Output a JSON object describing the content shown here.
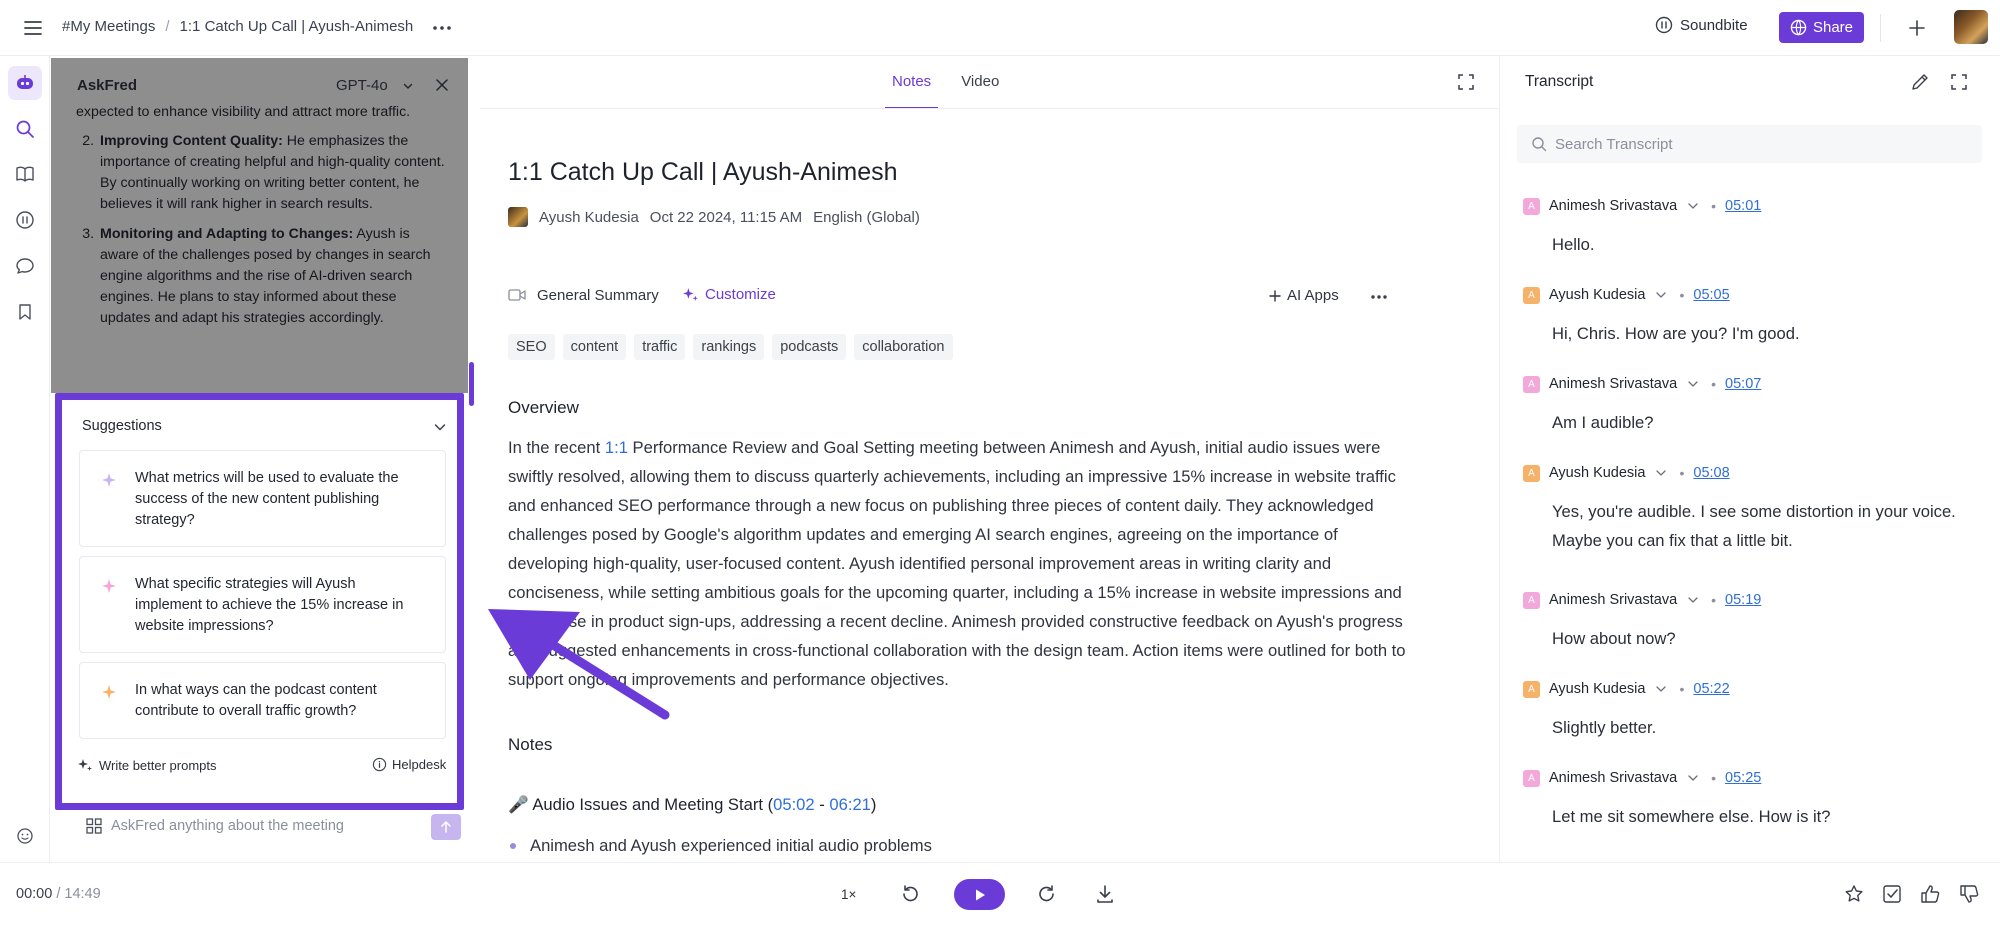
{
  "header": {
    "breadcrumb_root": "#My Meetings",
    "breadcrumb_sep": "/",
    "breadcrumb_current": "1:1 Catch Up Call | Ayush-Animesh",
    "soundbite_label": "Soundbite",
    "share_label": "Share"
  },
  "askfred": {
    "title": "AskFred",
    "model": "GPT-4o",
    "partial_top": "expected to enhance visibility and attract more traffic.",
    "items": [
      {
        "bold": "Improving Content Quality:",
        "text": " He emphasizes the importance of creating helpful and high-quality content. By continually working on writing better content, he believes it will rank higher in search results."
      },
      {
        "bold": "Monitoring and Adapting to Changes:",
        "text": " Ayush is aware of the challenges posed by changes in search engine algorithms and the rise of AI-driven search engines. He plans to stay informed about these updates and adapt his strategies accordingly."
      }
    ],
    "suggestions_label": "Suggestions",
    "suggestions": [
      "What metrics will be used to evaluate the success of the new content publishing strategy?",
      "What specific strategies will Ayush implement to achieve the 15% increase in website impressions?",
      "In what ways can the podcast content contribute to overall traffic growth?"
    ],
    "write_better": "Write better prompts",
    "helpdesk": "Helpdesk",
    "input_placeholder": "AskFred anything about the meeting"
  },
  "center": {
    "tab_notes": "Notes",
    "tab_video": "Video",
    "title": "1:1 Catch Up Call | Ayush-Animesh",
    "author": "Ayush Kudesia",
    "date": "Oct 22 2024, 11:15 AM",
    "language": "English (Global)",
    "general_summary": "General Summary",
    "customize": "Customize",
    "ai_apps": "AI Apps",
    "tags": [
      "SEO",
      "content",
      "traffic",
      "rankings",
      "podcasts",
      "collaboration"
    ],
    "overview_heading": "Overview",
    "overview_pre": "In the recent ",
    "overview_link": "1:1",
    "overview_post": " Performance Review and Goal Setting meeting between Animesh and Ayush, initial audio issues were swiftly resolved, allowing them to discuss quarterly achievements, including an impressive 15% increase in website traffic and enhanced SEO performance through a new focus on publishing three pieces of content daily. They acknowledged challenges posed by Google's algorithm updates and emerging AI search engines, agreeing on the importance of developing high-quality, user-focused content. Ayush identified personal improvement areas in writing clarity and conciseness, while setting ambitious goals for the upcoming quarter, including a 15% increase in website impressions and a 10% rise in product sign-ups, addressing a recent decline. Animesh provided constructive feedback on Ayush's progress and suggested enhancements in cross-functional collaboration with the design team. Action items were outlined for both to support ongoing improvements and performance objectives.",
    "notes_heading": "Notes",
    "audio_emoji": "🎤",
    "audio_title": " Audio Issues and Meeting Start (",
    "audio_t1": "05:02",
    "audio_dash": " - ",
    "audio_t2": "06:21",
    "audio_close": ")",
    "bullet1": "Animesh and Ayush experienced initial audio problems"
  },
  "transcript": {
    "title": "Transcript",
    "search_placeholder": "Search Transcript",
    "entries": [
      {
        "initial": "A",
        "speaker": "Animesh Srivastava",
        "time": "05:01",
        "text": "Hello.",
        "color": "#f2a8d8"
      },
      {
        "initial": "A",
        "speaker": "Ayush Kudesia",
        "time": "05:05",
        "text": "Hi, Chris. How are you? I'm good.",
        "color": "#f7b26a"
      },
      {
        "initial": "A",
        "speaker": "Animesh Srivastava",
        "time": "05:07",
        "text": "Am I audible?",
        "color": "#f2a8d8"
      },
      {
        "initial": "A",
        "speaker": "Ayush Kudesia",
        "time": "05:08",
        "text": "Yes, you're audible. I see some distortion in your voice. Maybe you can fix that a little bit.",
        "color": "#f7b26a"
      },
      {
        "initial": "A",
        "speaker": "Animesh Srivastava",
        "time": "05:19",
        "text": "How about now?",
        "color": "#f2a8d8"
      },
      {
        "initial": "A",
        "speaker": "Ayush Kudesia",
        "time": "05:22",
        "text": "Slightly better.",
        "color": "#f7b26a"
      },
      {
        "initial": "A",
        "speaker": "Animesh Srivastava",
        "time": "05:25",
        "text": "Let me sit somewhere else. How is it?",
        "color": "#f2a8d8"
      }
    ]
  },
  "player": {
    "current": "00:00",
    "sep": " / ",
    "total": "14:49",
    "speed": "1×"
  },
  "colors": {
    "accent": "#6b3bd8",
    "link": "#2f6fd6"
  }
}
